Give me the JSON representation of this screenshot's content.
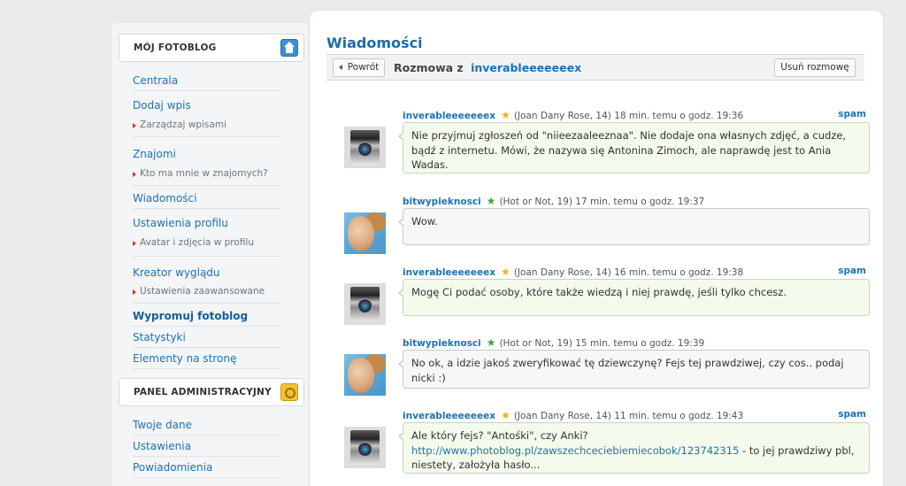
{
  "sidebar": {
    "section1_title": "MÓJ FOTOBLOG",
    "items": [
      {
        "label": "Centrala"
      },
      {
        "label": "Dodaj wpis"
      },
      {
        "label": "Zarządzaj wpisami"
      },
      {
        "label": "Znajomi"
      },
      {
        "label": "Kto ma mnie w znajomych?"
      },
      {
        "label": "Wiadomości"
      },
      {
        "label": "Ustawienia profilu"
      },
      {
        "label": "Avatar i zdjęcia w profilu"
      },
      {
        "label": "Kreator wyglądu"
      },
      {
        "label": "Ustawienia zaawansowane"
      },
      {
        "label": "Wypromuj fotoblog"
      },
      {
        "label": "Statystyki"
      },
      {
        "label": "Elementy na stronę"
      }
    ],
    "section2_title": "PANEL ADMINISTRACYJNY",
    "admin_items": [
      {
        "label": "Twoje dane"
      },
      {
        "label": "Ustawienia"
      },
      {
        "label": "Powiadomienia"
      }
    ]
  },
  "main": {
    "title": "Wiadomości",
    "back_label": "Powrót",
    "conversation_prefix": "Rozmowa z",
    "conversation_user": "inverableeeeeeex",
    "delete_label": "Usuń rozmowę",
    "spam_label": "spam",
    "messages": [
      {
        "author": "inverableeeeeeex",
        "info": "(Joan Dany Rose, 14) 18 min. temu o godz. 19:36",
        "text": "Nie przyjmuj zgłoszeń od \"niieezaaleeznaa\". Nie dodaje ona własnych zdjęć, a cudze, bądź z internetu. Mówi, że nazywa się Antonina Zimoch, ale naprawdę jest to Ania Wadas."
      },
      {
        "author": "bitwypieknosci",
        "info": "(Hot or Not, 19) 17 min. temu o godz. 19:37",
        "text": "Wow."
      },
      {
        "author": "inverableeeeeeex",
        "info": "(Joan Dany Rose, 14) 16 min. temu o godz. 19:38",
        "text": "Mogę Ci podać osoby, które także wiedzą i niej prawdę, jeśli tylko chcesz."
      },
      {
        "author": "bitwypieknosci",
        "info": "(Hot or Not, 19) 15 min. temu o godz. 19:39",
        "text": "No ok, a idzie jakoś zweryfikować tę dziewczynę? Fejs tej prawdziwej, czy cos.. podaj nicki :)"
      },
      {
        "author": "inverableeeeeeex",
        "info": "(Joan Dany Rose, 14) 11 min. temu o godz. 19:43",
        "text_before": "Ale który fejs? \"Antośki\", czy Anki?",
        "link": "http://www.photoblog.pl/zawszechceciebiemiecobok/123742315",
        "text_after": "- to jej prawdziwy pbl, niestety, założyła hasło..."
      }
    ]
  }
}
